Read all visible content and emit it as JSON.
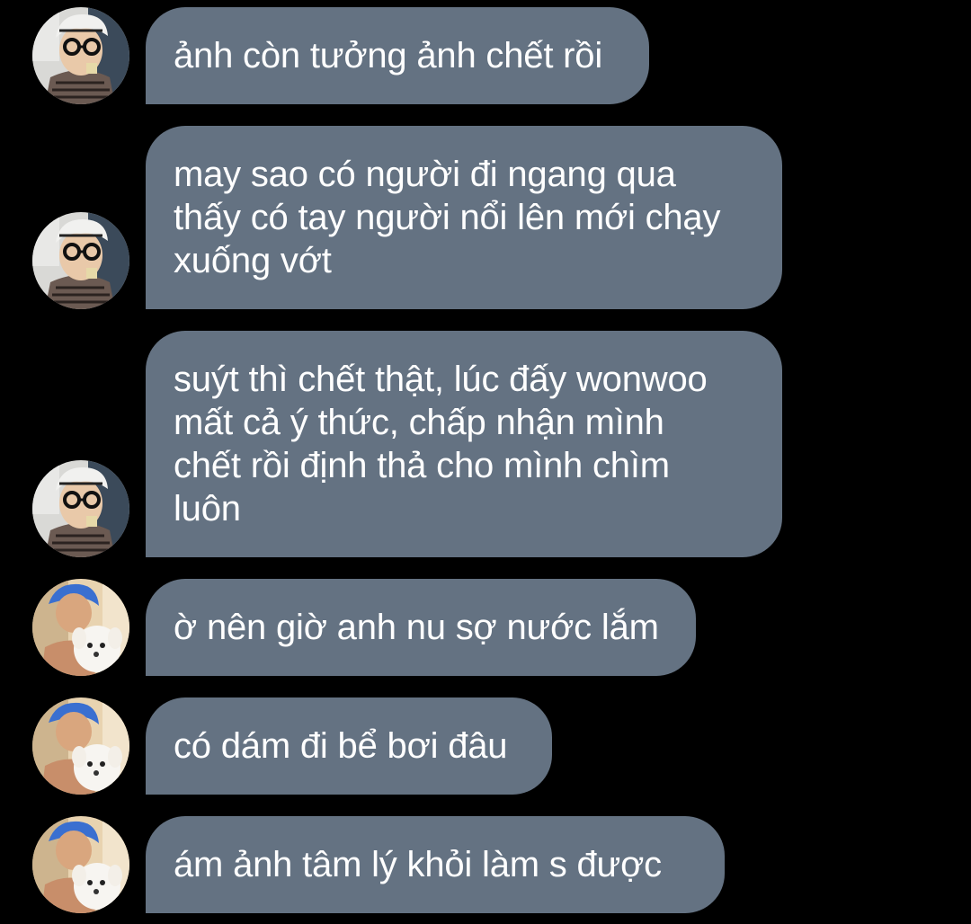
{
  "colors": {
    "background": "#000000",
    "bubble": "#647282",
    "text": "#ffffff"
  },
  "avatars": {
    "a": "avatar-glasses-person",
    "b": "avatar-blue-hair-with-puppy"
  },
  "messages": [
    {
      "sender": "a",
      "text": "ảnh còn tưởng ảnh chết rồi"
    },
    {
      "sender": "a",
      "text": "may sao có người đi ngang qua\nthấy có tay người nổi lên mới chạy\nxuống vớt"
    },
    {
      "sender": "a",
      "text": "suýt thì chết thật, lúc đấy wonwoo\nmất cả ý thức, chấp nhận mình\nchết rồi định thả cho mình chìm\nluôn"
    },
    {
      "sender": "b",
      "text": "ờ nên giờ anh nu sợ nước lắm"
    },
    {
      "sender": "b",
      "text": "có dám đi bể bơi đâu"
    },
    {
      "sender": "b",
      "text": "ám ảnh tâm lý khỏi làm s được"
    }
  ]
}
